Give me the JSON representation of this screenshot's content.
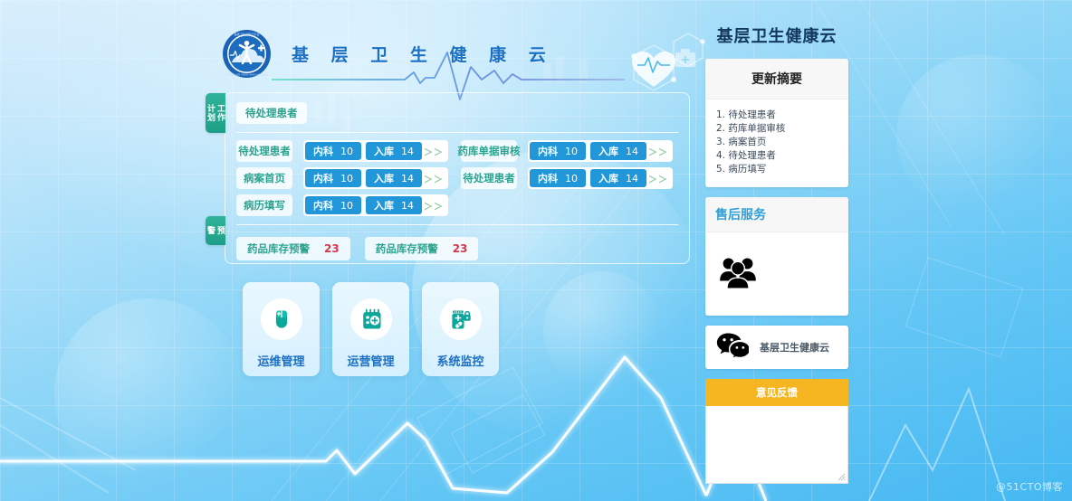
{
  "brand": {
    "title": "基 层 卫 生 健 康 云",
    "logo_icon": "health-cloud-logo-icon"
  },
  "work_panel": {
    "tabs": [
      {
        "label": "工作计划",
        "name": "tab-work-plan"
      },
      {
        "label": "预警",
        "name": "tab-warning"
      }
    ],
    "headline_chip": "待处理患者",
    "rows": [
      {
        "label": "待处理患者",
        "tag1_label": "内科",
        "tag1_count": "10",
        "tag2_label": "入库",
        "tag2_count": "14",
        "more": "＞＞"
      },
      {
        "label": "病案首页",
        "tag1_label": "内科",
        "tag1_count": "10",
        "tag2_label": "入库",
        "tag2_count": "14",
        "more": "＞＞"
      },
      {
        "label": "病历填写",
        "tag1_label": "内科",
        "tag1_count": "10",
        "tag2_label": "入库",
        "tag2_count": "14",
        "more": "＞＞"
      }
    ],
    "rows_right": [
      {
        "label": "药库单据审核",
        "tag1_label": "内科",
        "tag1_count": "10",
        "tag2_label": "入库",
        "tag2_count": "14",
        "more": "＞＞"
      },
      {
        "label": "待处理患者",
        "tag1_label": "内科",
        "tag1_count": "10",
        "tag2_label": "入库",
        "tag2_count": "14",
        "more": "＞＞"
      }
    ],
    "warnings": [
      {
        "label": "药品库存预警",
        "count": "23"
      },
      {
        "label": "药品库存预警",
        "count": "23"
      }
    ]
  },
  "cards": [
    {
      "label": "运维管理",
      "icon": "mouse-icon"
    },
    {
      "label": "运营管理",
      "icon": "calendar-plus-icon"
    },
    {
      "label": "系统监控",
      "icon": "medicine-bottle-lock-icon"
    }
  ],
  "right": {
    "title": "基层卫生健康云",
    "update_summary": {
      "heading": "更新摘要",
      "items": [
        "1. 待处理患者",
        "2. 药库单据审核",
        "3. 病案首页",
        "4. 待处理患者",
        "5. 病历填写"
      ]
    },
    "service": {
      "heading": "售后服务",
      "icon": "people-group-icon"
    },
    "wechat": {
      "icon": "wechat-icon",
      "text": "基层卫生健康云"
    },
    "feedback": {
      "heading": "意见反馈",
      "placeholder": ""
    }
  },
  "watermark": "@51CTO博客",
  "colors": {
    "brand_blue": "#1b6fc4",
    "tag_blue": "#2196d8",
    "teal": "#2aa48f",
    "alert_red": "#d9364a",
    "feedback_amber": "#f5b622"
  }
}
